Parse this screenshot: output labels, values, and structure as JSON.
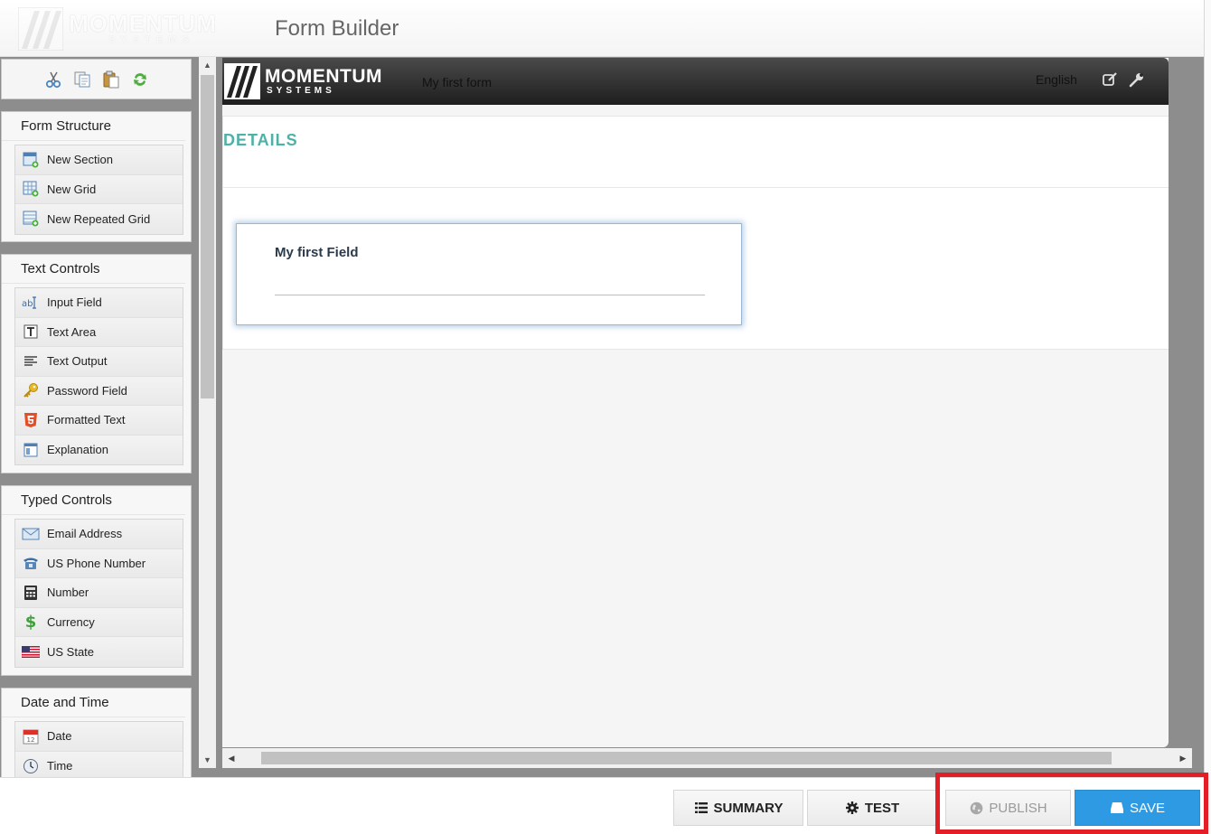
{
  "app": {
    "logo_word": "MOMENTUM",
    "logo_sub": "SYSTEMS",
    "title": "Form Builder"
  },
  "toolbar": {
    "icons": [
      "cut-icon",
      "copy-icon",
      "paste-icon",
      "refresh-icon"
    ]
  },
  "palette": {
    "form_structure": {
      "title": "Form Structure",
      "items": [
        {
          "label": "New Section",
          "icon": "new-section-icon"
        },
        {
          "label": "New Grid",
          "icon": "new-grid-icon"
        },
        {
          "label": "New Repeated Grid",
          "icon": "new-repeated-grid-icon"
        }
      ]
    },
    "text_controls": {
      "title": "Text Controls",
      "items": [
        {
          "label": "Input Field",
          "icon": "input-field-icon"
        },
        {
          "label": "Text Area",
          "icon": "text-area-icon"
        },
        {
          "label": "Text Output",
          "icon": "text-output-icon"
        },
        {
          "label": "Password Field",
          "icon": "key-icon"
        },
        {
          "label": "Formatted Text",
          "icon": "html5-icon"
        },
        {
          "label": "Explanation",
          "icon": "explanation-icon"
        }
      ]
    },
    "typed_controls": {
      "title": "Typed Controls",
      "items": [
        {
          "label": "Email Address",
          "icon": "envelope-icon"
        },
        {
          "label": "US Phone Number",
          "icon": "phone-icon"
        },
        {
          "label": "Number",
          "icon": "calculator-icon"
        },
        {
          "label": "Currency",
          "icon": "dollar-icon"
        },
        {
          "label": "US State",
          "icon": "us-flag-icon"
        }
      ]
    },
    "date_time": {
      "title": "Date and Time",
      "items": [
        {
          "label": "Date",
          "icon": "calendar-icon",
          "day": "12"
        },
        {
          "label": "Time",
          "icon": "clock-icon"
        }
      ]
    }
  },
  "form": {
    "logo_word": "MOMENTUM",
    "logo_sub": "SYSTEMS",
    "name": "My first form",
    "language": "English",
    "section_title": "DETAILS",
    "field_label": "My first Field"
  },
  "footer": {
    "summary_label": "SUMMARY",
    "test_label": "TEST",
    "publish_label": "PUBLISH",
    "save_label": "SAVE"
  },
  "colors": {
    "section_title": "#4fb1a6",
    "save_button": "#2e9ae3",
    "highlight": "#e41e26"
  }
}
